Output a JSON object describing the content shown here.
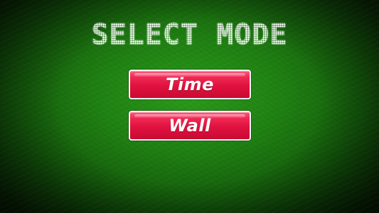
{
  "screen": {
    "title": "SELECT MODE"
  },
  "modes": [
    {
      "label": "Time"
    },
    {
      "label": "Wall"
    }
  ],
  "colors": {
    "background": "#1f8012",
    "button_fill": "#e0123f",
    "button_border": "#f4f4f4",
    "text": "#ffffff"
  }
}
